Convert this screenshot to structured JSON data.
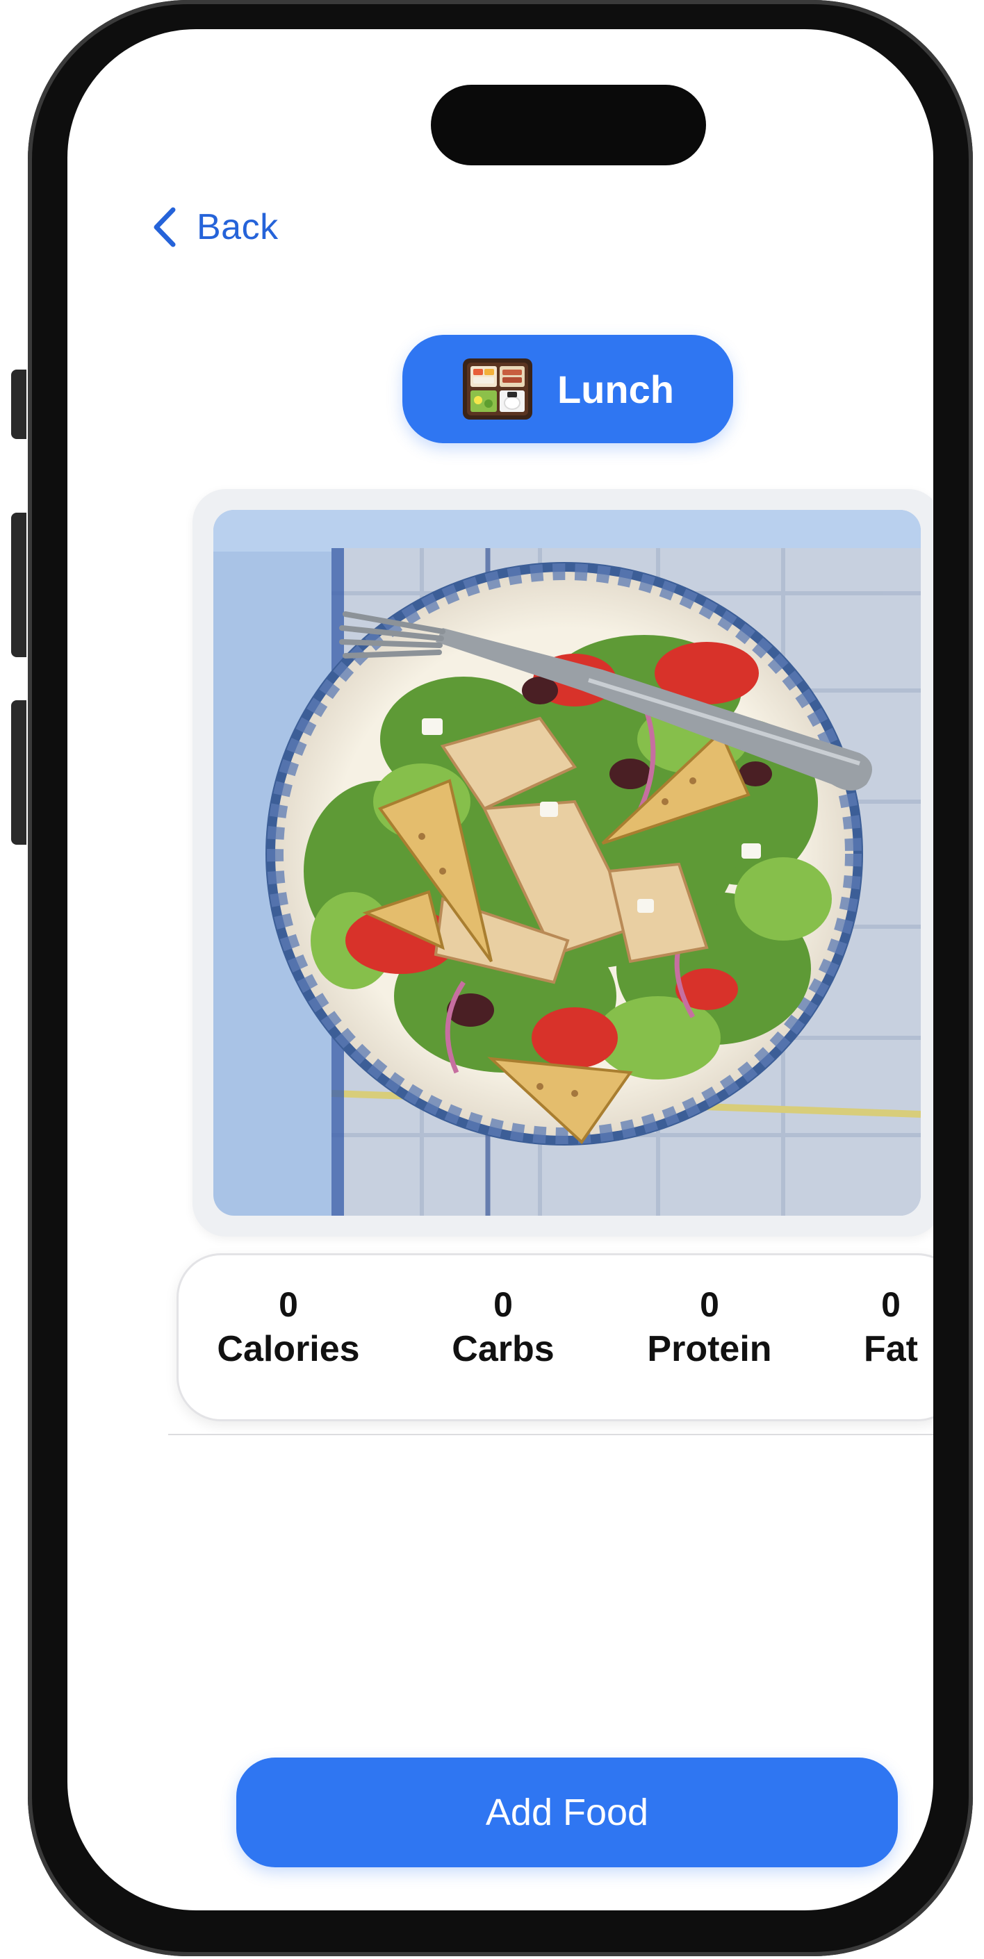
{
  "nav": {
    "back_label": "Back"
  },
  "meal": {
    "label": "Lunch",
    "icon": "bento-box-icon"
  },
  "photo": {
    "subject": "salad-bowl-photo"
  },
  "nutrition": {
    "items": [
      {
        "value": "0",
        "label": "Calories"
      },
      {
        "value": "0",
        "label": "Carbs"
      },
      {
        "value": "0",
        "label": "Protein"
      },
      {
        "value": "0",
        "label": "Fat"
      }
    ]
  },
  "actions": {
    "add_food_label": "Add Food"
  },
  "colors": {
    "accent": "#2f76f2",
    "link": "#2563d9",
    "text": "#111111"
  }
}
